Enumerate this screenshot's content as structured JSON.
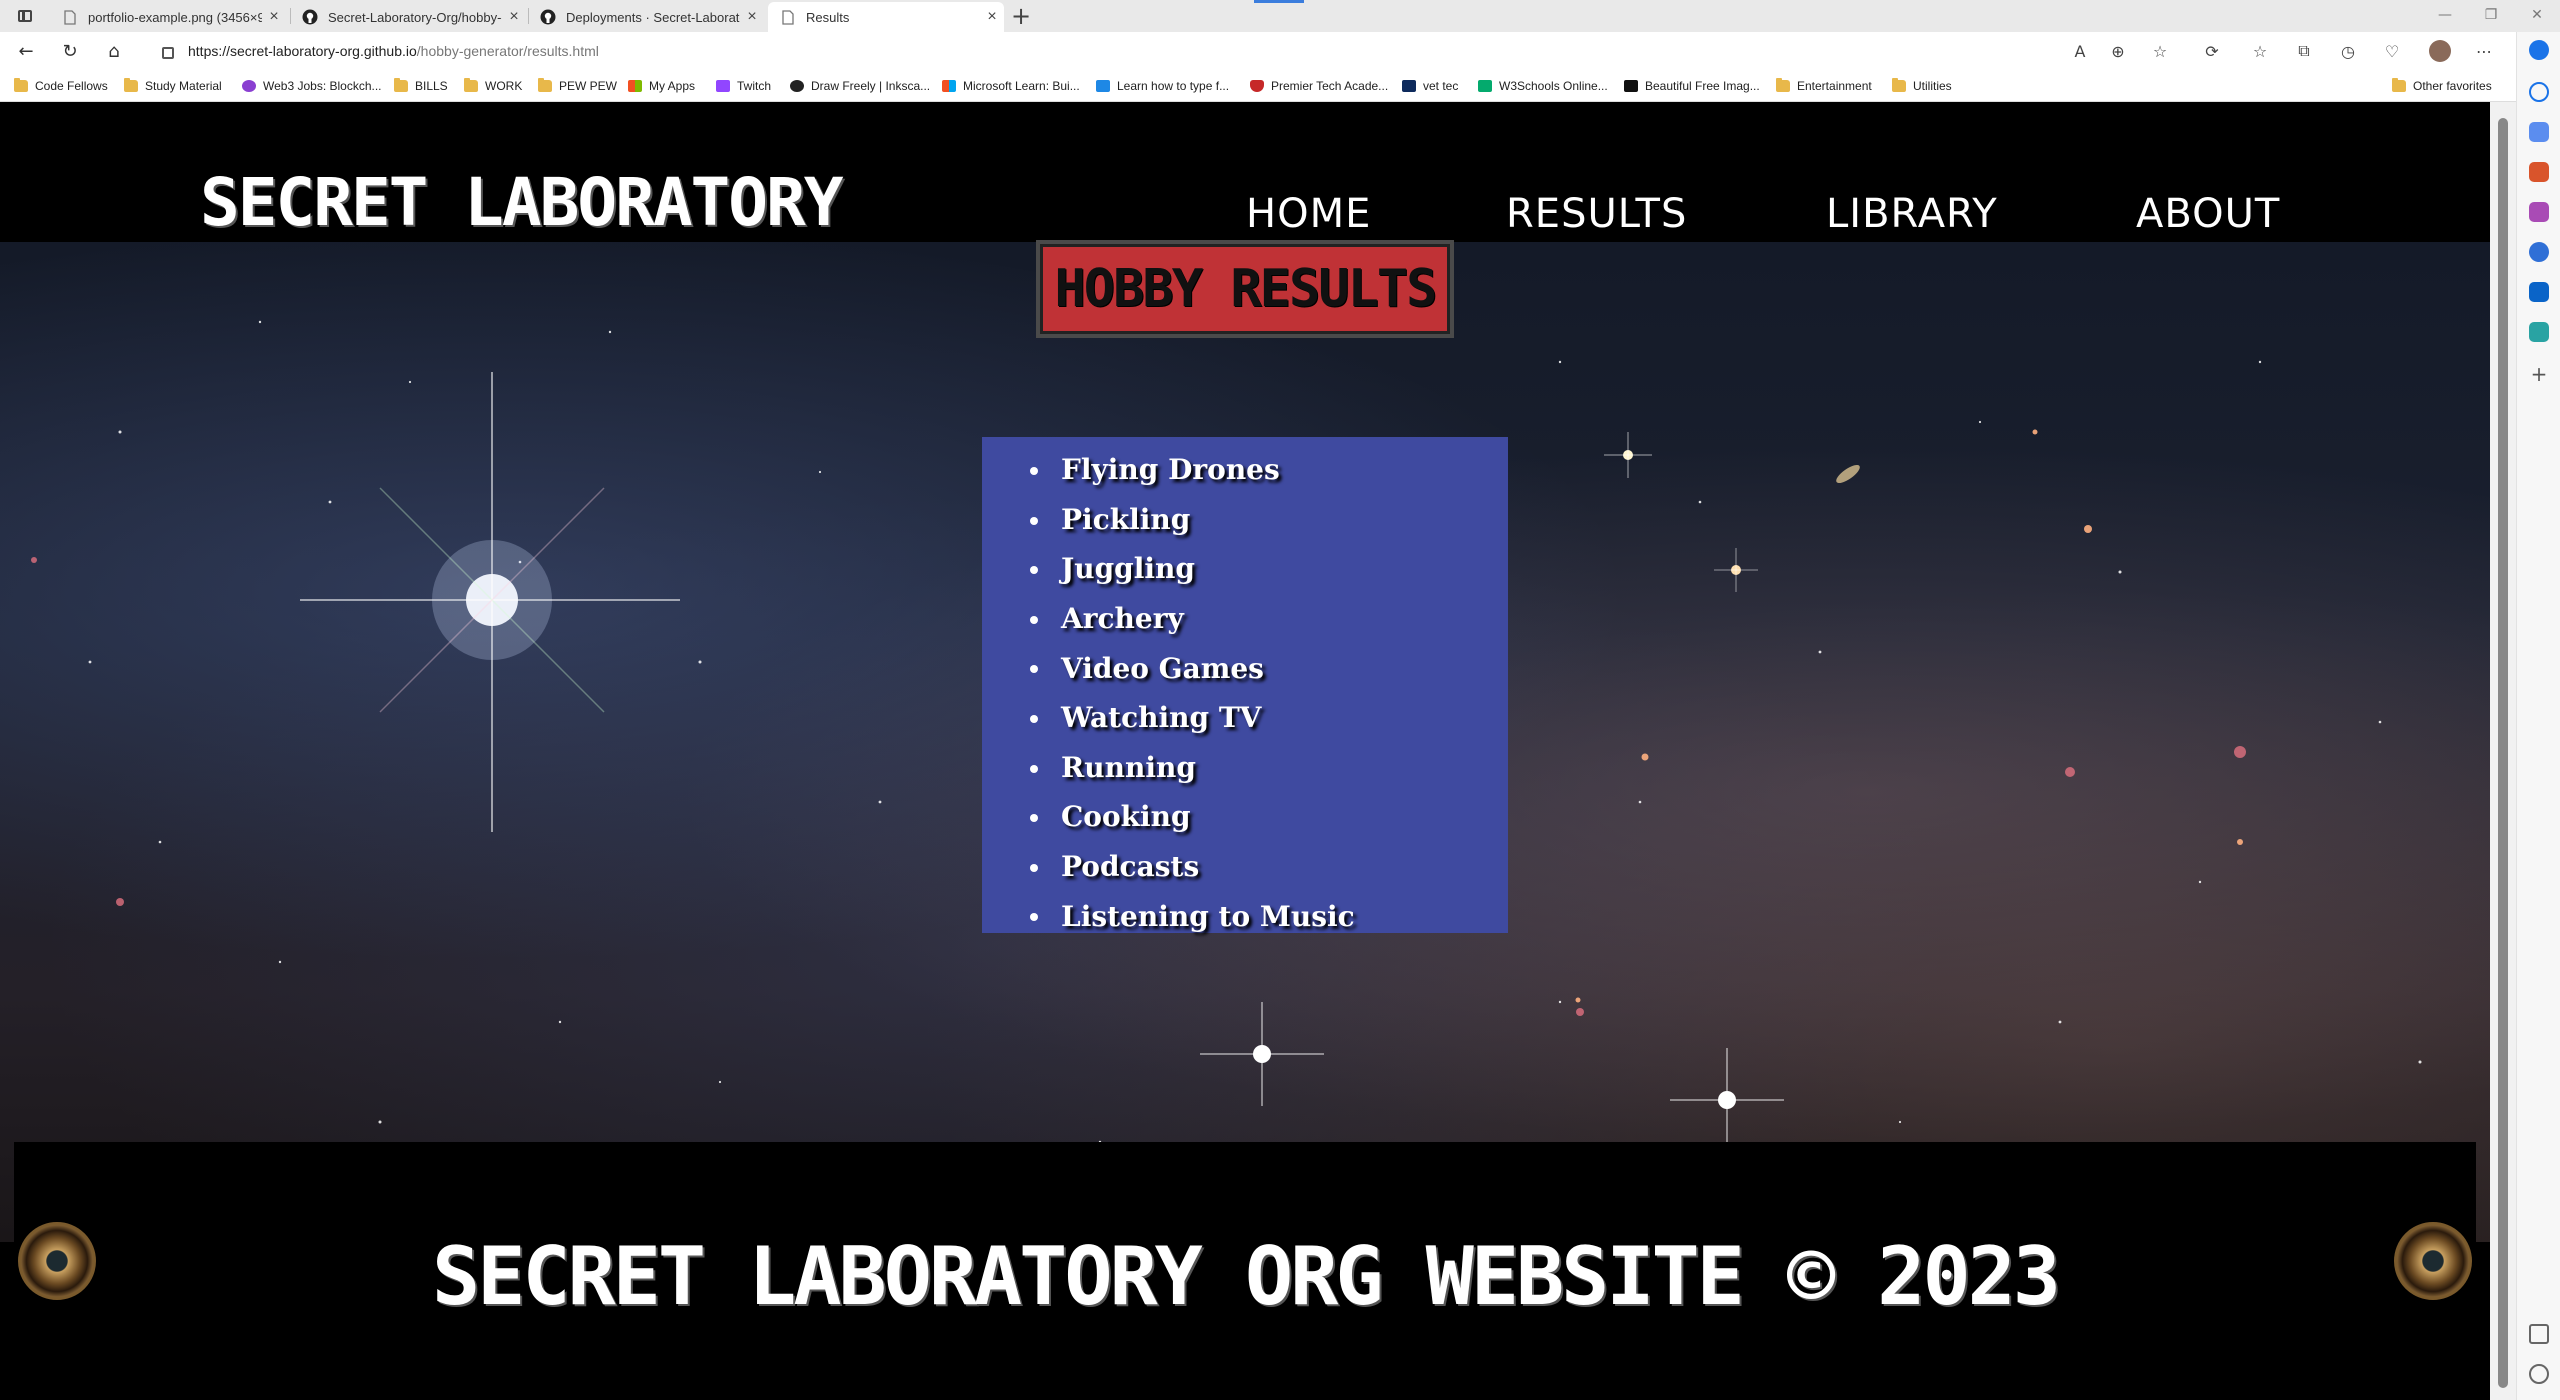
{
  "browser": {
    "tabs": [
      {
        "title": "portfolio-example.png (3456×9…",
        "icon": "file-icon"
      },
      {
        "title": "Secret-Laboratory-Org/hobby-g…",
        "icon": "github-icon"
      },
      {
        "title": "Deployments · Secret-Laborator…",
        "icon": "github-icon"
      },
      {
        "title": "Results",
        "icon": "file-icon"
      }
    ],
    "url_host": "https://secret-laboratory-org.github.io",
    "url_path": "/hobby-generator/results.html",
    "favorites": [
      {
        "label": "Code Fellows",
        "icon": "folder-icon"
      },
      {
        "label": "Study Material",
        "icon": "folder-icon"
      },
      {
        "label": "Web3 Jobs: Blockch...",
        "icon": "web3-icon"
      },
      {
        "label": "BILLS",
        "icon": "folder-icon"
      },
      {
        "label": "WORK",
        "icon": "folder-icon"
      },
      {
        "label": "PEW PEW",
        "icon": "folder-icon"
      },
      {
        "label": "My Apps",
        "icon": "apps-icon"
      },
      {
        "label": "Twitch",
        "icon": "twitch-icon"
      },
      {
        "label": "Draw Freely | Inksca...",
        "icon": "inkscape-icon"
      },
      {
        "label": "Microsoft Learn: Bui...",
        "icon": "microsoft-icon"
      },
      {
        "label": "Learn how to type f...",
        "icon": "typing-icon"
      },
      {
        "label": "Premier Tech Acade...",
        "icon": "shield-icon"
      },
      {
        "label": "vet tec",
        "icon": "va-icon"
      },
      {
        "label": "W3Schools Online...",
        "icon": "w3schools-icon"
      },
      {
        "label": "Beautiful Free Imag...",
        "icon": "unsplash-icon"
      },
      {
        "label": "Entertainment",
        "icon": "folder-icon"
      },
      {
        "label": "Utilities",
        "icon": "folder-icon"
      }
    ],
    "other_favorites": "Other favorites"
  },
  "site": {
    "logo": "SECRET LABORATORY",
    "nav": {
      "home": "HOME",
      "results": "RESULTS",
      "library": "LIBRARY",
      "about": "ABOUT"
    },
    "page_title": "HOBBY RESULTS",
    "hobbies": [
      "Flying Drones",
      "Pickling",
      "Juggling",
      "Archery",
      "Video Games",
      "Watching TV",
      "Running",
      "Cooking",
      "Podcasts",
      "Listening to Music"
    ],
    "footer": "SECRET LABORATORY ORG WEBSITE © 2023"
  },
  "colors": {
    "title_box": "#c03236",
    "results_box": "#3f4aa0",
    "header_bg": "#000000"
  }
}
